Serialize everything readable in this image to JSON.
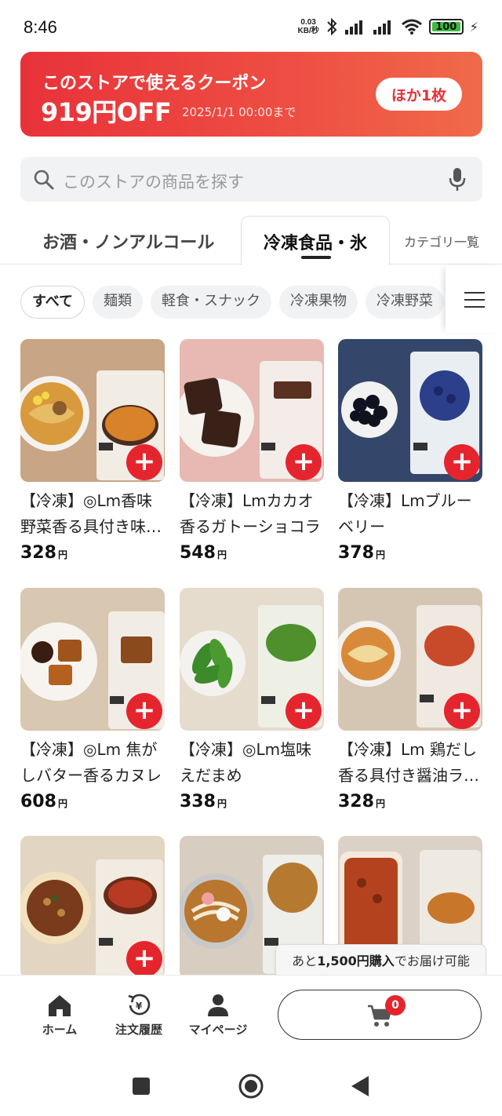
{
  "status_bar": {
    "time": "8:46",
    "net_speed_value": "0.03",
    "net_speed_unit": "KB/秒",
    "battery": "100"
  },
  "coupon": {
    "title": "このストアで使えるクーポン",
    "amount": "919円OFF",
    "until": "2025/1/1 00:00まで",
    "more_button": "ほか1枚"
  },
  "search": {
    "placeholder": "このストアの商品を探す"
  },
  "category_tabs": [
    {
      "label": "お酒・ノンアルコール",
      "active": false
    },
    {
      "label": "冷凍食品・氷",
      "active": true
    },
    {
      "label": "カテゴリ一覧",
      "active": false
    }
  ],
  "chips": [
    {
      "label": "すべて",
      "active": true
    },
    {
      "label": "麺類",
      "active": false
    },
    {
      "label": "軽食・スナック",
      "active": false
    },
    {
      "label": "冷凍果物",
      "active": false
    },
    {
      "label": "冷凍野菜",
      "active": false
    }
  ],
  "products": [
    {
      "name": "【冷凍】◎Lm香味野菜香る具付き味噌ラーメン",
      "price": "328",
      "yen": "円"
    },
    {
      "name": "【冷凍】Lmカカオ香るガトーショコラ",
      "price": "548",
      "yen": "円"
    },
    {
      "name": "【冷凍】Lmブルーベリー",
      "price": "378",
      "yen": "円"
    },
    {
      "name": "【冷凍】◎Lm 焦がしバター香るカヌレ",
      "price": "608",
      "yen": "円"
    },
    {
      "name": "【冷凍】◎Lm塩味えだまめ",
      "price": "338",
      "yen": "円"
    },
    {
      "name": "【冷凍】Lm 鶏だし香る具付き醤油ラーメン",
      "price": "328",
      "yen": "円"
    },
    {
      "name": "",
      "price": "",
      "yen": ""
    },
    {
      "name": "",
      "price": "",
      "yen": ""
    },
    {
      "name": "",
      "price": "",
      "yen": ""
    }
  ],
  "tooltip": {
    "prefix": "あと",
    "amount": "1,500円購入",
    "suffix": "でお届け可能"
  },
  "bottom_nav": {
    "home": "ホーム",
    "orders": "注文履歴",
    "mypage": "マイページ",
    "cart_count": "0"
  },
  "colors": {
    "accent_red": "#e5252d",
    "coupon_gradient_start": "#e8323a",
    "coupon_gradient_end": "#f06a4a"
  }
}
